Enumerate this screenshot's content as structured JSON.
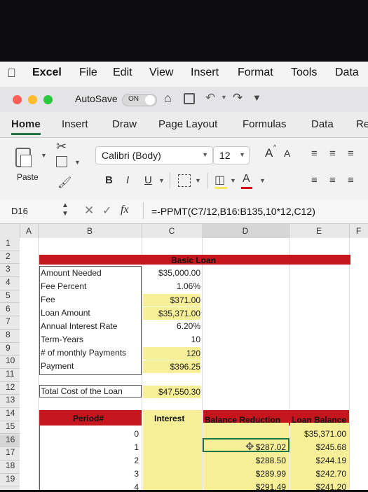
{
  "menubar": {
    "items": [
      "Excel",
      "File",
      "Edit",
      "View",
      "Insert",
      "Format",
      "Tools",
      "Data"
    ]
  },
  "titlebar": {
    "autosave_label": "AutoSave",
    "autosave_state": "ON"
  },
  "ribbon_tabs": [
    "Home",
    "Insert",
    "Draw",
    "Page Layout",
    "Formulas",
    "Data",
    "Re"
  ],
  "ribbon": {
    "paste_label": "Paste",
    "font_name": "Calibri (Body)",
    "font_size": "12",
    "bold": "B",
    "italic": "I",
    "underline": "U",
    "grow_font": "A",
    "shrink_font": "A",
    "font_color_letter": "A"
  },
  "formula_bar": {
    "name_box": "D16",
    "fx": "fx",
    "formula": "=-PPMT(C7/12,B16:B135,10*12,C12)"
  },
  "columns": [
    "A",
    "B",
    "C",
    "D",
    "E",
    "F"
  ],
  "rows": [
    "1",
    "2",
    "3",
    "4",
    "5",
    "6",
    "7",
    "8",
    "9",
    "10",
    "11",
    "12",
    "13",
    "14",
    "15",
    "16",
    "17",
    "18",
    "19"
  ],
  "sheet": {
    "header_title": "Basic Loan",
    "labels": {
      "r3": "Amount Needed",
      "r4": "Fee Percent",
      "r5": "Fee",
      "r6": "Loan Amount",
      "r7": "Annual Interest Rate",
      "r8": "Term-Years",
      "r9": "# of monthly Payments",
      "r10": "Payment",
      "r12": "Total Cost of the Loan"
    },
    "values": {
      "r3": "$35,000.00",
      "r4": "1.06%",
      "r5": "$371.00",
      "r6": "$35,371.00",
      "r7": "6.20%",
      "r8": "10",
      "r9": "120",
      "r10": "$396.25",
      "r12": "$47,550.30"
    },
    "table_headers": [
      "Period#",
      "Interest",
      "Balance Reduction",
      "Loan Balance"
    ],
    "table_rows": [
      {
        "period": "0",
        "balance_reduction": "",
        "loan_balance": "$35,371.00"
      },
      {
        "period": "1",
        "balance_reduction": "$287.02",
        "loan_balance": "$245.68"
      },
      {
        "period": "2",
        "balance_reduction": "$288.50",
        "loan_balance": "$244.19"
      },
      {
        "period": "3",
        "balance_reduction": "$289.99",
        "loan_balance": "$242.70"
      },
      {
        "period": "4",
        "balance_reduction": "$291.49",
        "loan_balance": "$241.20"
      }
    ]
  },
  "colors": {
    "header_red": "#c4161c",
    "input_yellow": "#f7ef98",
    "selection_green": "#217346"
  }
}
